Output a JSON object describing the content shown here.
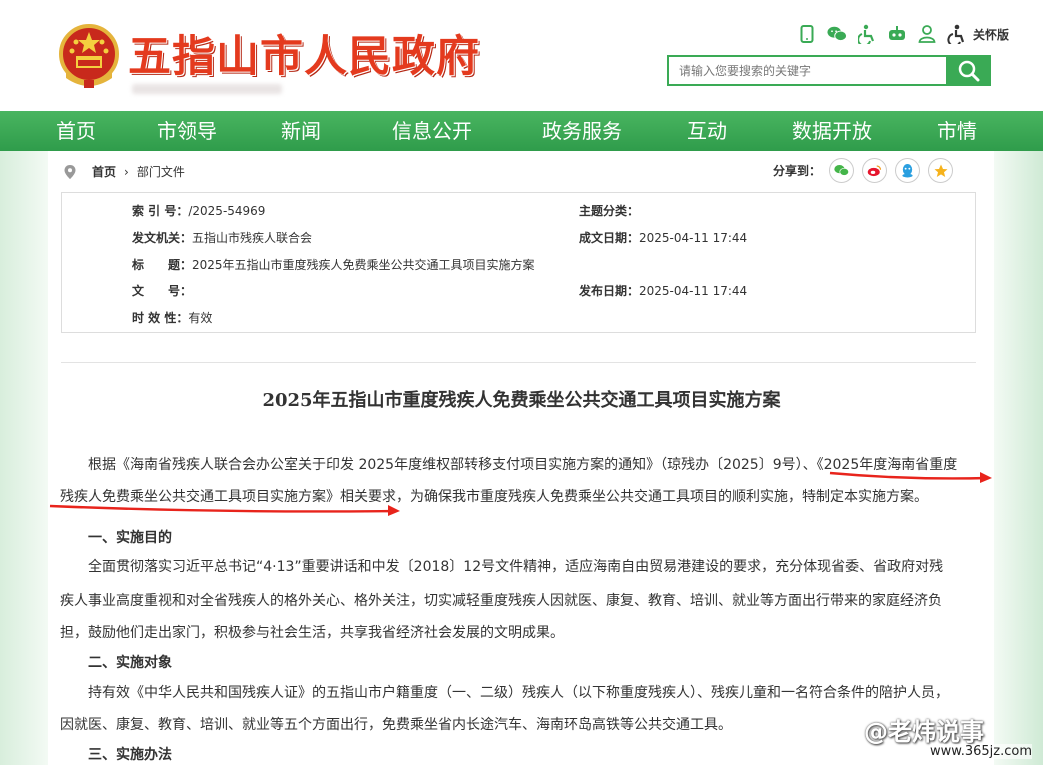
{
  "header": {
    "site_title": "五指山市人民政府",
    "care_mode_label": "关怀版",
    "icons": [
      "mobile-icon",
      "wechat-icon",
      "accessibility-icon",
      "robot-icon",
      "user-icon",
      "care-mode-icon"
    ],
    "search": {
      "placeholder": "请输入您要搜索的关键字",
      "value": ""
    },
    "accent_color": "#3aaa55",
    "title_color": "#e43a1e"
  },
  "nav": {
    "items": [
      "首页",
      "市领导",
      "新闻",
      "信息公开",
      "政务服务",
      "互动",
      "数据开放",
      "市情"
    ]
  },
  "breadcrumb": {
    "home": "首页",
    "separator": "›",
    "current": "部门文件"
  },
  "share": {
    "label": "分享到：",
    "targets": [
      "wechat",
      "weibo",
      "qq",
      "qzone"
    ]
  },
  "meta": {
    "index_label": "索 引 号：",
    "index_value": "/2025-54969",
    "topic_label": "主题分类：",
    "topic_value": "",
    "org_label": "发文机关：",
    "org_value": "五指山市残疾人联合会",
    "date_label": "成文日期：",
    "date_value": "2025-04-11 17:44",
    "title_label": "标　　题：",
    "title_value": "2025年五指山市重度残疾人免费乘坐公共交通工具项目实施方案",
    "docno_label": "文　　号：",
    "docno_value": "",
    "publish_label": "发布日期：",
    "publish_value": "2025-04-11 17:44",
    "validity_label": "时 效 性：",
    "validity_value": "有效"
  },
  "document": {
    "title": "2025年五指山市重度残疾人免费乘坐公共交通工具项目实施方案",
    "intro_line1": "根据《海南省残疾人联合会办公室关于印发 2025年度维权部转移支付项目实施方案的通知》（琼残办〔2025〕9号）、《2025年度海南省重度",
    "intro_line2": "残疾人免费乘坐公共交通工具项目实施方案》相关要求，为确保我市重度残疾人免费乘坐公共交通工具项目的顺利实施，特制定本实施方案。",
    "section1_title": "一、实施目的",
    "section1_line1": "全面贯彻落实习近平总书记“4·13”重要讲话和中发〔2018〕12号文件精神，适应海南自由贸易港建设的要求，充分体现省委、省政府对残",
    "section1_line2": "疾人事业高度重视和对全省残疾人的格外关心、格外关注，切实减轻重度残疾人因就医、康复、教育、培训、就业等方面出行带来的家庭经济负",
    "section1_line3": "担，鼓励他们走出家门，积极参与社会生活，共享我省经济社会发展的文明成果。",
    "section2_title": "二、实施对象",
    "section2_line1": "持有效《中华人民共和国残疾人证》的五指山市户籍重度（一、二级）残疾人（以下称重度残疾人）、残疾儿童和一名符合条件的陪护人员，",
    "section2_line2": "因就医、康复、教育、培训、就业等五个方面出行，免费乘坐省内长途汽车、海南环岛高铁等公共交通工具。",
    "section3_title": "三、实施办法"
  },
  "watermark": {
    "text": "@老炜说事",
    "url": "www.365jz.com"
  }
}
